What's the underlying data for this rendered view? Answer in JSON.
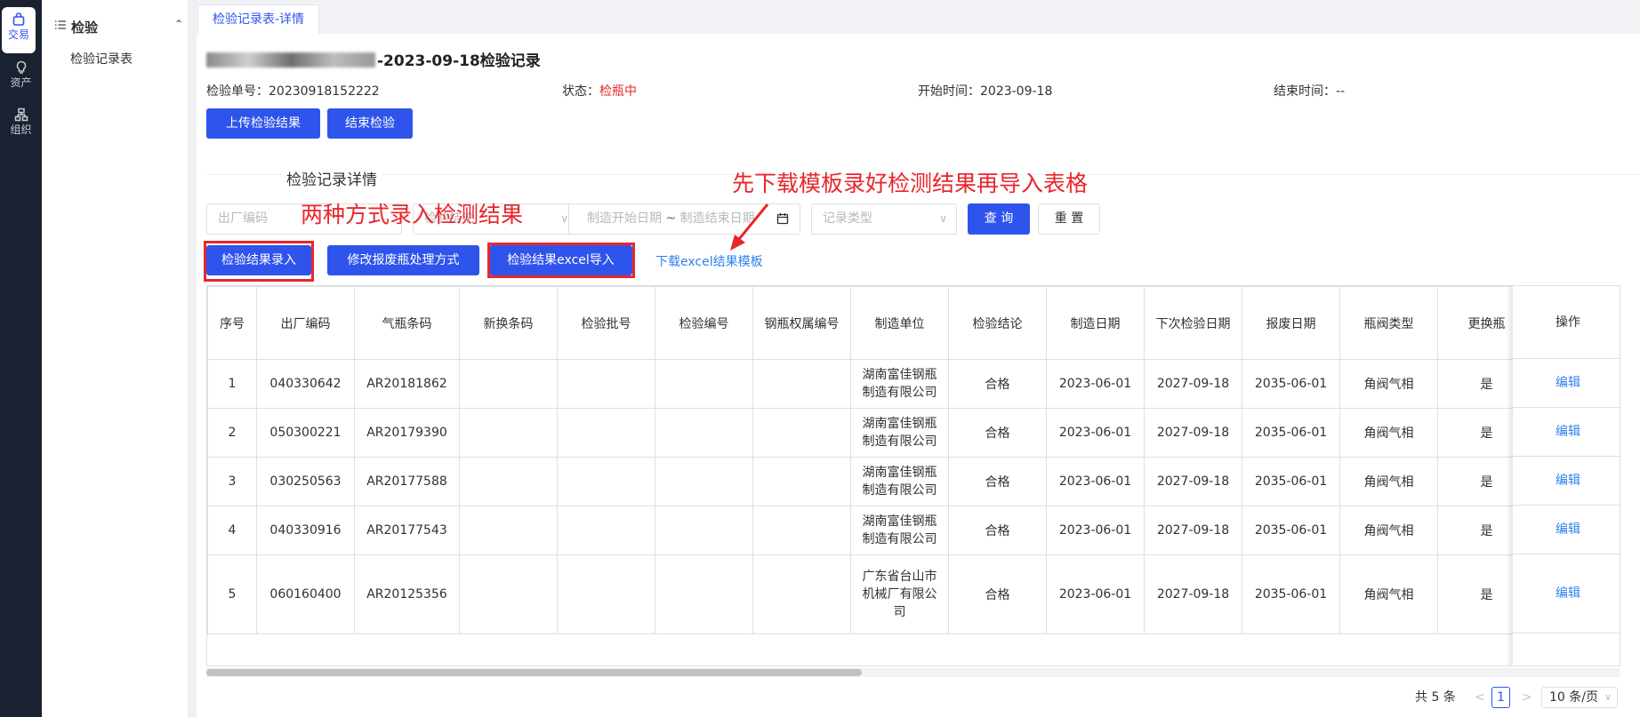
{
  "rail": {
    "items": [
      {
        "label": "交易",
        "icon": "bag-icon"
      },
      {
        "label": "资产",
        "icon": "lightbulb-icon"
      },
      {
        "label": "组织",
        "icon": "org-chart-icon"
      }
    ]
  },
  "sidebar": {
    "group_title": "检验",
    "items": [
      "检验记录表"
    ]
  },
  "tabs": {
    "active": "检验记录表-详情"
  },
  "header": {
    "title_suffix": "-2023-09-18检验记录",
    "order_no_label": "检验单号：",
    "order_no": "20230918152222",
    "status_label": "状态：",
    "status": "检瓶中",
    "start_label": "开始时间：",
    "start": "2023-09-18",
    "end_label": "结束时间：",
    "end": "--"
  },
  "actions": {
    "upload": "上传检验结果",
    "finish": "结束检验"
  },
  "section": {
    "title": "检验记录详情"
  },
  "filters": {
    "factory_code_placeholder": "出厂编码",
    "hidden_placeholder": "检验结论",
    "date_start_placeholder": "制造开始日期",
    "date_sep": "~",
    "date_end_placeholder": "制造结束日期",
    "record_type_placeholder": "记录类型",
    "query": "查 询",
    "reset": "重 置"
  },
  "toolbar": {
    "entry": "检验结果录入",
    "modify_scrap": "修改报废瓶处理方式",
    "excel_import": "检验结果excel导入",
    "download_template": "下载excel结果模板"
  },
  "annotations": {
    "two_ways": "两种方式录入检测结果",
    "download_first": "先下载模板录好检测结果再导入表格"
  },
  "table": {
    "columns": [
      "序号",
      "出厂编码",
      "气瓶条码",
      "新换条码",
      "检验批号",
      "检验编号",
      "钢瓶权属编号",
      "制造单位",
      "检验结论",
      "制造日期",
      "下次检验日期",
      "报废日期",
      "瓶阀类型",
      "更换瓶"
    ],
    "op_column": "操作",
    "rows": [
      {
        "no": "1",
        "code": "040330642",
        "barcode": "AR20181862",
        "new_code": "",
        "batch": "",
        "insp_no": "",
        "owner_no": "",
        "maker": "湖南富佳钢瓶制造有限公司",
        "result": "合格",
        "made": "2023-06-01",
        "next": "2027-09-18",
        "scrap": "2035-06-01",
        "valve": "角阀气相",
        "replace": "是",
        "op": "编辑"
      },
      {
        "no": "2",
        "code": "050300221",
        "barcode": "AR20179390",
        "new_code": "",
        "batch": "",
        "insp_no": "",
        "owner_no": "",
        "maker": "湖南富佳钢瓶制造有限公司",
        "result": "合格",
        "made": "2023-06-01",
        "next": "2027-09-18",
        "scrap": "2035-06-01",
        "valve": "角阀气相",
        "replace": "是",
        "op": "编辑"
      },
      {
        "no": "3",
        "code": "030250563",
        "barcode": "AR20177588",
        "new_code": "",
        "batch": "",
        "insp_no": "",
        "owner_no": "",
        "maker": "湖南富佳钢瓶制造有限公司",
        "result": "合格",
        "made": "2023-06-01",
        "next": "2027-09-18",
        "scrap": "2035-06-01",
        "valve": "角阀气相",
        "replace": "是",
        "op": "编辑"
      },
      {
        "no": "4",
        "code": "040330916",
        "barcode": "AR20177543",
        "new_code": "",
        "batch": "",
        "insp_no": "",
        "owner_no": "",
        "maker": "湖南富佳钢瓶制造有限公司",
        "result": "合格",
        "made": "2023-06-01",
        "next": "2027-09-18",
        "scrap": "2035-06-01",
        "valve": "角阀气相",
        "replace": "是",
        "op": "编辑"
      },
      {
        "no": "5",
        "code": "060160400",
        "barcode": "AR20125356",
        "new_code": "",
        "batch": "",
        "insp_no": "",
        "owner_no": "",
        "maker": "广东省台山市机械厂有限公司",
        "result": "合格",
        "made": "2023-06-01",
        "next": "2027-09-18",
        "scrap": "2035-06-01",
        "valve": "角阀气相",
        "replace": "是",
        "op": "编辑"
      }
    ]
  },
  "pagination": {
    "total": "共 5 条",
    "prev": "<",
    "page": "1",
    "next": ">",
    "page_size": "10 条/页"
  },
  "colors": {
    "primary": "#2f54eb",
    "danger": "#e02b2b",
    "annotation": "#e8262c",
    "link": "#2f80ed",
    "rail": "#1a2130"
  }
}
